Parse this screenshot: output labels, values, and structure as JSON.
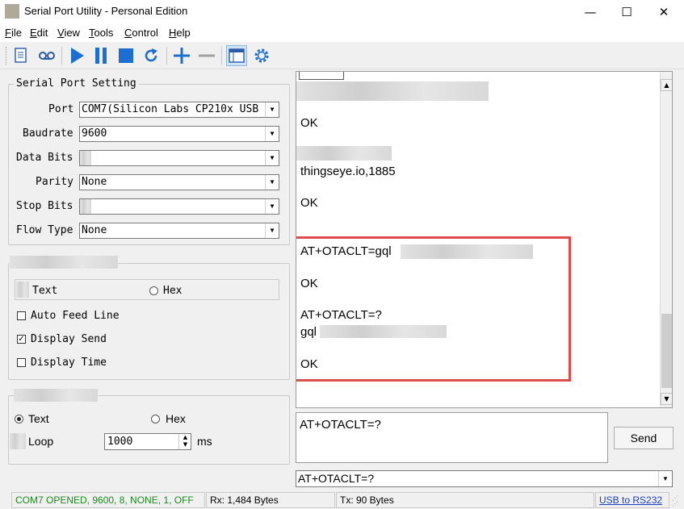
{
  "window": {
    "title": "Serial Port Utility - Personal Edition",
    "min": "—",
    "max": "☐",
    "close": "✕"
  },
  "menu": [
    {
      "underline": "F",
      "rest": "ile"
    },
    {
      "underline": "E",
      "rest": "dit"
    },
    {
      "underline": "V",
      "rest": "iew"
    },
    {
      "underline": "T",
      "rest": "ools"
    },
    {
      "underline": "C",
      "rest": "ontrol"
    },
    {
      "underline": "H",
      "rest": "elp"
    }
  ],
  "toolbar": {
    "icons": [
      "document-icon",
      "cassette-icon",
      "play-icon",
      "pause-icon",
      "stop-icon",
      "refresh-icon",
      "plus-icon",
      "minus-icon",
      "window-icon",
      "gear-icon"
    ],
    "accent": "#1c6fd1"
  },
  "serial_settings": {
    "title": "Serial Port Setting",
    "port_label": "Port",
    "port_value": "COM7(Silicon Labs CP210x USB",
    "baud_label": "Baudrate",
    "baud_value": "9600",
    "databits_label": "Data Bits",
    "databits_value": "",
    "parity_label": "Parity",
    "parity_value": "None",
    "stopbits_label": "Stop Bits",
    "stopbits_value": "",
    "flow_label": "Flow Type",
    "flow_value": "None"
  },
  "receive_settings": {
    "text_label": "Text",
    "hex_label": "Hex",
    "auto_feed_label": "Auto Feed Line",
    "auto_feed_checked": false,
    "display_send_label": "Display Send",
    "display_send_checked": true,
    "display_time_label": "Display Time",
    "display_time_checked": false
  },
  "send_settings": {
    "text_label": "Text",
    "text_selected": true,
    "hex_label": "Hex",
    "loop_label": "Loop",
    "loop_value": "1000",
    "loop_unit": "ms"
  },
  "receive_lines": {
    "ok1": "OK",
    "server": "thingseye.io,1885",
    "ok2": "OK",
    "otaclt_set": "AT+OTACLT=gql",
    "ok3": "OK",
    "otaclt_query": "AT+OTACLT=?",
    "otaclt_resp": "gql",
    "ok4": "OK"
  },
  "send_area": {
    "value": "AT+OTACLT=?",
    "send_button": "Send",
    "history_value": "AT+OTACLT=?"
  },
  "status": {
    "connection": "COM7 OPENED, 9600, 8, NONE, 1, OFF",
    "connection_color": "#1a8a1a",
    "rx": "Rx: 1,484 Bytes",
    "tx": "Tx: 90 Bytes",
    "link": "USB to RS232",
    "link_color": "#1a3fbf"
  }
}
